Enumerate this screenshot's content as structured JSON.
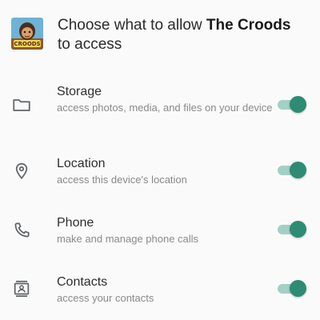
{
  "header": {
    "title_prefix": "Choose what to allow ",
    "app_name": "The Croods",
    "title_suffix": "to access",
    "app_icon": "the-croods-app-icon",
    "app_icon_text": "CROODS"
  },
  "permissions": [
    {
      "name": "Storage",
      "description": "access photos, media, and files on your device",
      "icon": "folder-icon",
      "enabled": true
    },
    {
      "name": "Location",
      "description": "access this device's location",
      "icon": "location-pin-icon",
      "enabled": true
    },
    {
      "name": "Phone",
      "description": "make and manage phone calls",
      "icon": "phone-icon",
      "enabled": true
    },
    {
      "name": "Contacts",
      "description": "access your contacts",
      "icon": "contacts-icon",
      "enabled": true
    }
  ],
  "colors": {
    "accent": "#2e8b74",
    "track": "#a4cfc6",
    "background": "#fafafa",
    "title_text": "#2b2b2b",
    "secondary_text": "#8a8a8a",
    "icon": "#5f6368"
  }
}
